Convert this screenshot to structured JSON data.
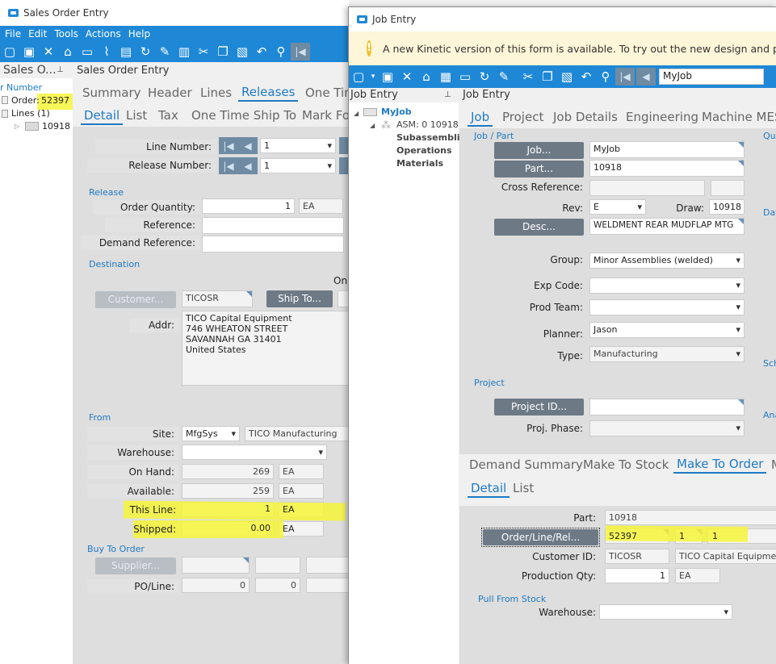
{
  "so": {
    "title": "Sales Order Entry",
    "menu": [
      "File",
      "Edit",
      "Tools",
      "Actions",
      "Help"
    ],
    "tree": {
      "header": "Sales O...",
      "search_label": "r Number",
      "order_label": "Order:",
      "order_value": "52397",
      "lines_label": "Lines (1)",
      "line_item": "10918"
    },
    "panel_title": "Sales Order Entry",
    "tabs1": [
      "Summary",
      "Header",
      "Lines",
      "Releases",
      "One Tim"
    ],
    "tabs2": [
      "Detail",
      "List",
      "Tax",
      "One Time Ship To",
      "Mark Fo"
    ],
    "line_number_label": "Line Number:",
    "line_number": "1",
    "release_number_label": "Release Number:",
    "release_number": "1",
    "release_section": "Release",
    "order_qty_label": "Order Quantity:",
    "order_qty": "1",
    "order_qty_uom": "EA",
    "reference_label": "Reference:",
    "demand_ref_label": "Demand Reference:",
    "destination_section": "Destination",
    "on_label": "On",
    "customer_btn": "Customer...",
    "customer_id": "TICOSR",
    "ship_to_btn": "Ship To...",
    "addr_label": "Addr:",
    "addr_lines": [
      "TICO Capital Equipment",
      "746 WHEATON STREET",
      "SAVANNAH GA 31401",
      "United States"
    ],
    "from_section": "From",
    "site_label": "Site:",
    "site": "MfgSys",
    "site_name": "TICO Manufacturing",
    "warehouse_label": "Warehouse:",
    "onhand_label": "On Hand:",
    "onhand": "269",
    "onhand_uom": "EA",
    "available_label": "Available:",
    "available": "259",
    "available_uom": "EA",
    "thisline_label": "This Line:",
    "thisline": "1",
    "thisline_uom": "EA",
    "shipped_label": "Shipped:",
    "shipped": "0.00",
    "shipped_uom": "EA",
    "buy_section": "Buy To Order",
    "supplier_btn": "Supplier...",
    "poline_label": "PO/Line:",
    "po": "0",
    "line": "0"
  },
  "je": {
    "title": "Job Entry",
    "banner": "A new Kinetic version of this form is available. To try out the new design and prov",
    "search_value": "MyJob",
    "tree_header": "Job Entry",
    "tree_job": "MyJob",
    "tree_asm": "ASM: 0 10918",
    "tree_children": [
      "Subassembli",
      "Operations",
      "Materials"
    ],
    "panel_title": "Job Entry",
    "tabs1": [
      "Job",
      "Project",
      "Job Details",
      "Engineering",
      "Machine MES"
    ],
    "job_part_section": "Job / Part",
    "job_btn": "Job...",
    "job": "MyJob",
    "part_btn": "Part...",
    "part": "10918",
    "crossref_label": "Cross Reference:",
    "rev_label": "Rev:",
    "rev": "E",
    "draw_label": "Draw:",
    "draw": "10918",
    "desc_btn": "Desc...",
    "desc": "WELDMENT REAR MUDFLAP MTG",
    "group_label": "Group:",
    "group": "Minor Assemblies (welded)",
    "expcode_label": "Exp Code:",
    "prodteam_label": "Prod Team:",
    "planner_label": "Planner:",
    "planner": "Jason",
    "type_label": "Type:",
    "type": "Manufacturing",
    "project_section": "Project",
    "projectid_btn": "Project ID...",
    "projphase_label": "Proj. Phase:",
    "right_clip": [
      "Qua",
      "Dat",
      "Sch",
      "Ana"
    ],
    "tabs2": [
      "Demand Summary",
      "Make To Stock",
      "Make To Order",
      "M"
    ],
    "tabs3": [
      "Detail",
      "List"
    ],
    "mto_part_label": "Part:",
    "mto_part": "10918",
    "olr_btn": "Order/Line/Rel...",
    "olr_order": "52397",
    "olr_line": "1",
    "olr_rel": "1",
    "customer_label": "Customer ID:",
    "customer": "TICOSR",
    "customer_name": "TICO Capital Equipment",
    "prodqty_label": "Production Qty:",
    "prodqty": "1",
    "prodqty_uom": "EA",
    "pull_section": "Pull From Stock",
    "pull_wh_label": "Warehouse:"
  }
}
